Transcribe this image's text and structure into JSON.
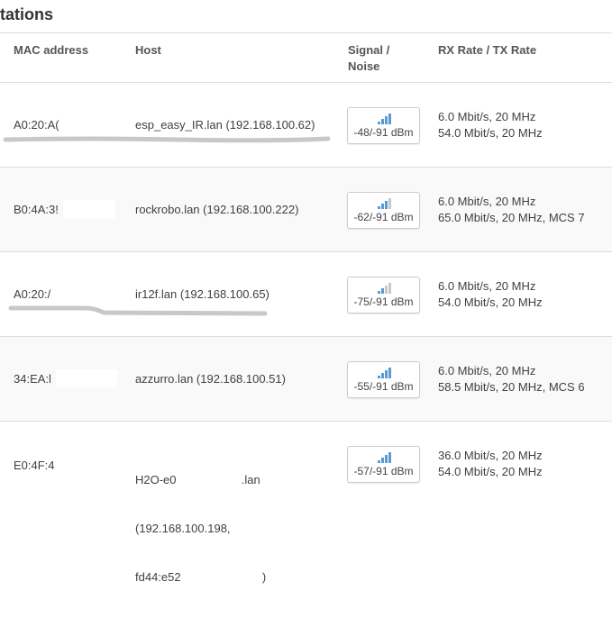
{
  "section": {
    "title": "tations"
  },
  "table": {
    "headers": {
      "mac": "MAC address",
      "host": "Host",
      "signal_line1": "Signal /",
      "signal_line2": "Noise",
      "rate": "RX Rate / TX Rate"
    },
    "rows": [
      {
        "mac": "A0:20:A(",
        "host_lines": [
          "esp_easy_IR.lan (192.168.100.62)"
        ],
        "signal": "-48/-91 dBm",
        "rx": "6.0 Mbit/s, 20 MHz",
        "tx": "54.0 Mbit/s, 20 MHz"
      },
      {
        "mac": "B0:4A:3!",
        "host_lines": [
          "rockrobo.lan (192.168.100.222)"
        ],
        "signal": "-62/-91 dBm",
        "rx": "6.0 Mbit/s, 20 MHz",
        "tx": "65.0 Mbit/s, 20 MHz, MCS 7"
      },
      {
        "mac": "A0:20:/",
        "host_lines": [
          "ir12f.lan (192.168.100.65)"
        ],
        "signal": "-75/-91 dBm",
        "rx": "6.0 Mbit/s, 20 MHz",
        "tx": "54.0 Mbit/s, 20 MHz"
      },
      {
        "mac": "34:EA:l",
        "host_lines": [
          "azzurro.lan (192.168.100.51)"
        ],
        "signal": "-55/-91 dBm",
        "rx": "6.0 Mbit/s, 20 MHz",
        "tx": "58.5 Mbit/s, 20 MHz, MCS 6"
      },
      {
        "mac": "E0:4F:4",
        "host_lines": [
          "H2O-e0                    .lan",
          "(192.168.100.198,",
          "fd44:e52                         )"
        ],
        "signal": "-57/-91 dBm",
        "rx": "36.0 Mbit/s, 20 MHz",
        "tx": "54.0 Mbit/s, 20 MHz"
      }
    ]
  }
}
